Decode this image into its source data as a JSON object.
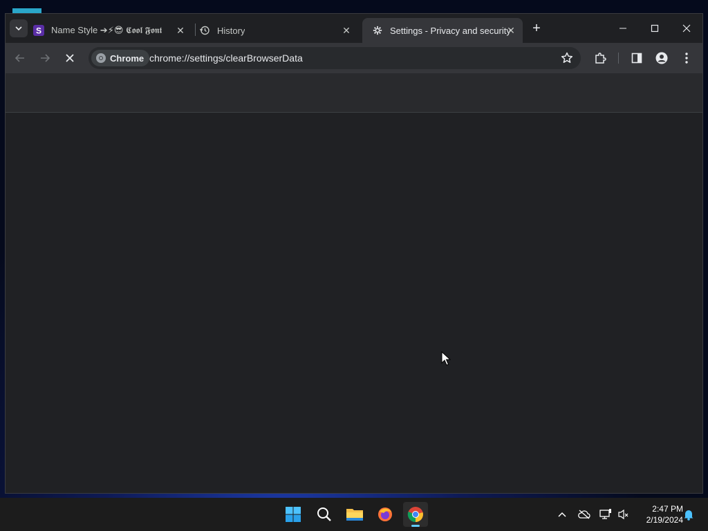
{
  "browser": {
    "tabs": [
      {
        "title": "Name Style ➔⚡😎 𝕮𝖔𝖔𝖑 𝕱𝖔𝖓𝖙𝖘 ⦙",
        "icon": "site-s-icon",
        "active": false
      },
      {
        "title": "History",
        "icon": "history-icon",
        "active": false
      },
      {
        "title": "Settings - Privacy and security",
        "icon": "settings-gear-icon",
        "active": true
      }
    ],
    "omnibox": {
      "chip_label": "Chrome",
      "url": "chrome://settings/clearBrowserData"
    }
  },
  "taskbar": {
    "apps": [
      "windows-start-icon",
      "search-icon",
      "file-explorer-icon",
      "firefox-icon",
      "chrome-icon"
    ],
    "clock_time": "2:47 PM",
    "clock_date": "2/19/2024"
  },
  "colors": {
    "window_bg": "#202124",
    "toolbar_bg": "#35363a",
    "taskbar_bg": "#1c1c1c",
    "accent": "#60cdff"
  }
}
